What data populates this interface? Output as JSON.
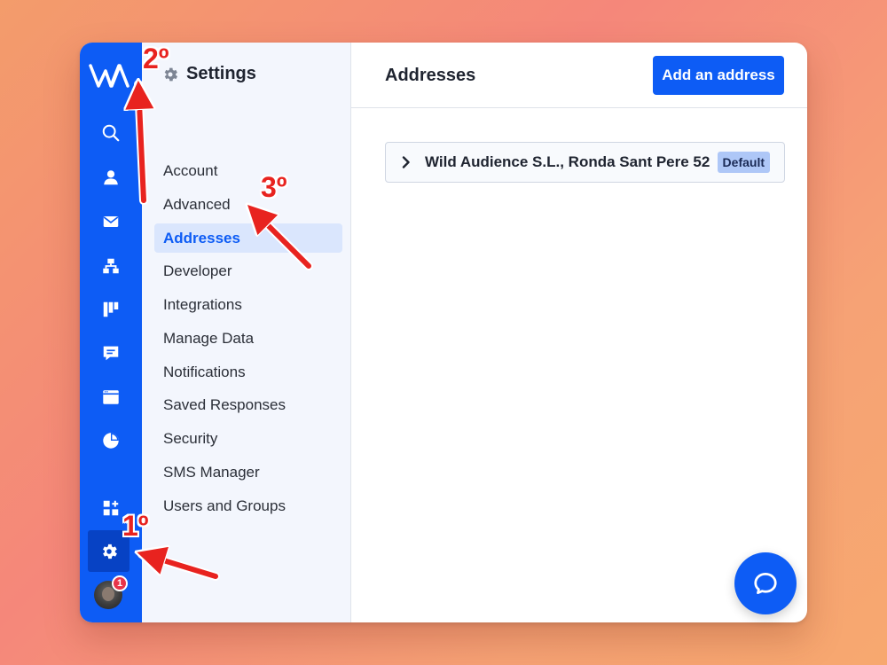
{
  "app": {
    "logo": "wa-logo",
    "accent": "#0d5cf5"
  },
  "rail": {
    "icons": [
      "search-icon",
      "person-icon",
      "mail-icon",
      "sitemap-icon",
      "board-icon",
      "chat-icon",
      "browser-icon",
      "pie-chart-icon",
      "apps-add-icon",
      "gear-icon"
    ],
    "avatar_badge": "1"
  },
  "settings": {
    "title": "Settings",
    "items": [
      {
        "label": "Account",
        "active": false
      },
      {
        "label": "Advanced",
        "active": false
      },
      {
        "label": "Addresses",
        "active": true
      },
      {
        "label": "Developer",
        "active": false
      },
      {
        "label": "Integrations",
        "active": false
      },
      {
        "label": "Manage Data",
        "active": false
      },
      {
        "label": "Notifications",
        "active": false
      },
      {
        "label": "Saved Responses",
        "active": false
      },
      {
        "label": "Security",
        "active": false
      },
      {
        "label": "SMS Manager",
        "active": false
      },
      {
        "label": "Users and Groups",
        "active": false
      }
    ]
  },
  "main": {
    "title": "Addresses",
    "add_button": "Add an address",
    "addresses": [
      {
        "label": "Wild Audience S.L., Ronda Sant Pere 52",
        "badge": "Default"
      }
    ]
  },
  "annotations": {
    "step1": "1º",
    "step2": "2º",
    "step3": "3º",
    "color": "#e8231f"
  }
}
